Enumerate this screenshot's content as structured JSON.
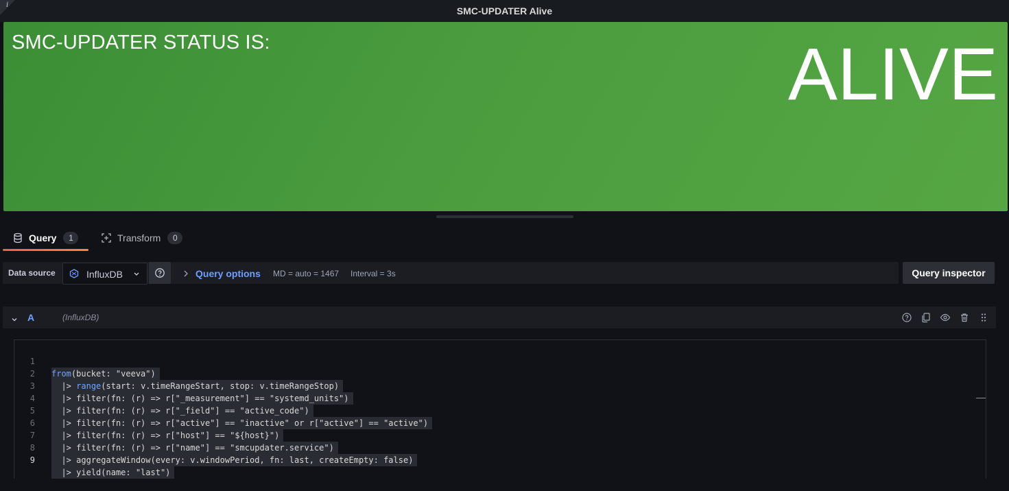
{
  "panel": {
    "title": "SMC-UPDATER Alive",
    "info_glyph": "i",
    "stat_prefix": "SMC-UPDATER STATUS IS:",
    "stat_value": "ALIVE",
    "stat_color": "#4a9c3e"
  },
  "tabs": [
    {
      "label": "Query",
      "count": "1",
      "active": true,
      "icon": "database-icon"
    },
    {
      "label": "Transform",
      "count": "0",
      "active": false,
      "icon": "transform-icon"
    }
  ],
  "datasource_row": {
    "label": "Data source",
    "selected": "InfluxDB",
    "query_options_label": "Query options",
    "md_text": "MD = auto = 1467",
    "interval_text": "Interval = 3s",
    "inspector_label": "Query inspector"
  },
  "query": {
    "ref_id": "A",
    "datasource": "(InfluxDB)",
    "lines": [
      {
        "n": "1",
        "indent": "",
        "pre": "",
        "text": "(bucket: \"veeva\")",
        "kw": "from",
        "rest": ""
      },
      {
        "n": "2",
        "indent": "  ",
        "pre": "|> ",
        "kw": "range",
        "text": "(start: v.timeRangeStart, stop: v.timeRangeStop)"
      },
      {
        "n": "3",
        "indent": "  ",
        "pre": "|> ",
        "kw": "",
        "text": "filter(fn: (r) => r[\"_measurement\"] == \"systemd_units\")"
      },
      {
        "n": "4",
        "indent": "  ",
        "pre": "|> ",
        "kw": "",
        "text": "filter(fn: (r) => r[\"_field\"] == \"active_code\")"
      },
      {
        "n": "5",
        "indent": "  ",
        "pre": "|> ",
        "kw": "",
        "text": "filter(fn: (r) => r[\"active\"] == \"inactive\" or r[\"active\"] == \"active\")"
      },
      {
        "n": "6",
        "indent": "  ",
        "pre": "|> ",
        "kw": "",
        "text": "filter(fn: (r) => r[\"host\"] == \"${host}\")"
      },
      {
        "n": "7",
        "indent": "  ",
        "pre": "|> ",
        "kw": "",
        "text": "filter(fn: (r) => r[\"name\"] == \"smcupdater.service\")"
      },
      {
        "n": "8",
        "indent": "  ",
        "pre": "|> ",
        "kw": "",
        "text": "aggregateWindow(every: v.windowPeriod, fn: last, createEmpty: false)"
      },
      {
        "n": "9",
        "indent": "  ",
        "pre": "|> ",
        "kw": "",
        "text": "yield(name: \"last\")"
      }
    ]
  },
  "colors": {
    "accent_blue": "#6e9fff",
    "tab_underline": "#f55f3e",
    "background": "#111217"
  }
}
